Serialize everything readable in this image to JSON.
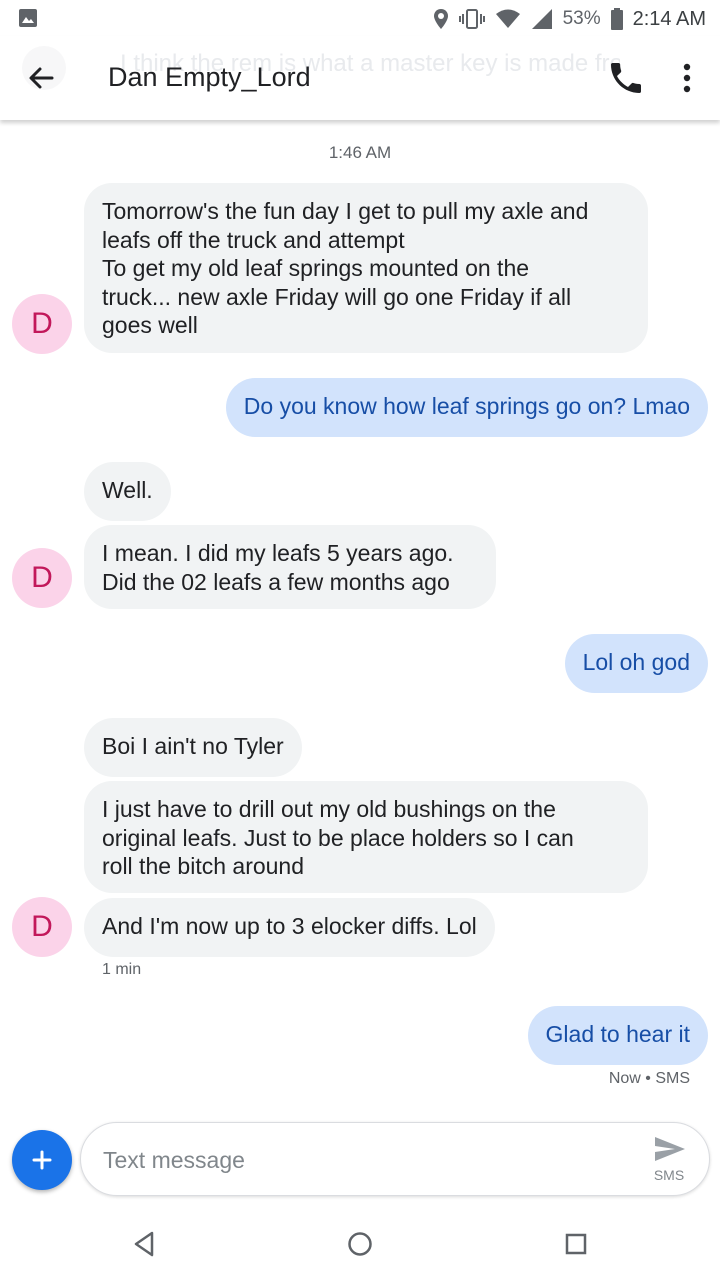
{
  "status_bar": {
    "battery_pct": "53%",
    "time": "2:14 AM"
  },
  "app_bar": {
    "ghost_preview": "I think the rem is what a master key is made from",
    "title": "Dan Empty_Lord",
    "back_icon": "arrow-back-icon",
    "call_icon": "phone-icon",
    "more_icon": "more-vert-icon"
  },
  "conversation": {
    "timestamp": "1:46 AM",
    "avatar_initial": "D",
    "messages": [
      {
        "dir": "in",
        "text": "Tomorrow's the fun day I get to pull my axle and leafs off the truck and attempt To get my old leaf springs mounted on the truck... new axle Friday will go one Friday if all goes well",
        "lines": [
          "Tomorrow's the fun day I get to pull my axle and",
          "leafs off the truck and attempt",
          "To get my old leaf springs mounted on the",
          "truck... new axle Friday will go one Friday if all",
          "goes well"
        ]
      },
      {
        "dir": "out",
        "text": "Do you know how leaf springs go on? Lmao"
      },
      {
        "dir": "in",
        "text": "Well."
      },
      {
        "dir": "in",
        "lines": [
          "I mean. I did my leafs 5 years ago.",
          "Did the 02 leafs a few months ago"
        ]
      },
      {
        "dir": "out",
        "text": "Lol oh god"
      },
      {
        "dir": "in",
        "text": "Boi I ain't no Tyler"
      },
      {
        "dir": "in",
        "lines": [
          "I just have to drill out my old bushings on the",
          "original leafs. Just to be place holders so I can",
          "roll the bitch around"
        ]
      },
      {
        "dir": "in",
        "text": "And I'm now up to 3 elocker diffs. Lol"
      },
      {
        "dir": "out",
        "text": "Glad to hear it"
      }
    ],
    "meta_1min": "1 min",
    "meta_now": "Now • SMS"
  },
  "compose": {
    "placeholder": "Text message",
    "send_label": "SMS",
    "fab_icon": "plus-icon"
  },
  "colors": {
    "incoming_bubble": "#f1f3f4",
    "outgoing_bubble": "#d2e3fc",
    "outgoing_text": "#174ea6",
    "avatar_bg": "#fbd3e9",
    "avatar_text": "#c2185b",
    "fab": "#1a73e8"
  }
}
